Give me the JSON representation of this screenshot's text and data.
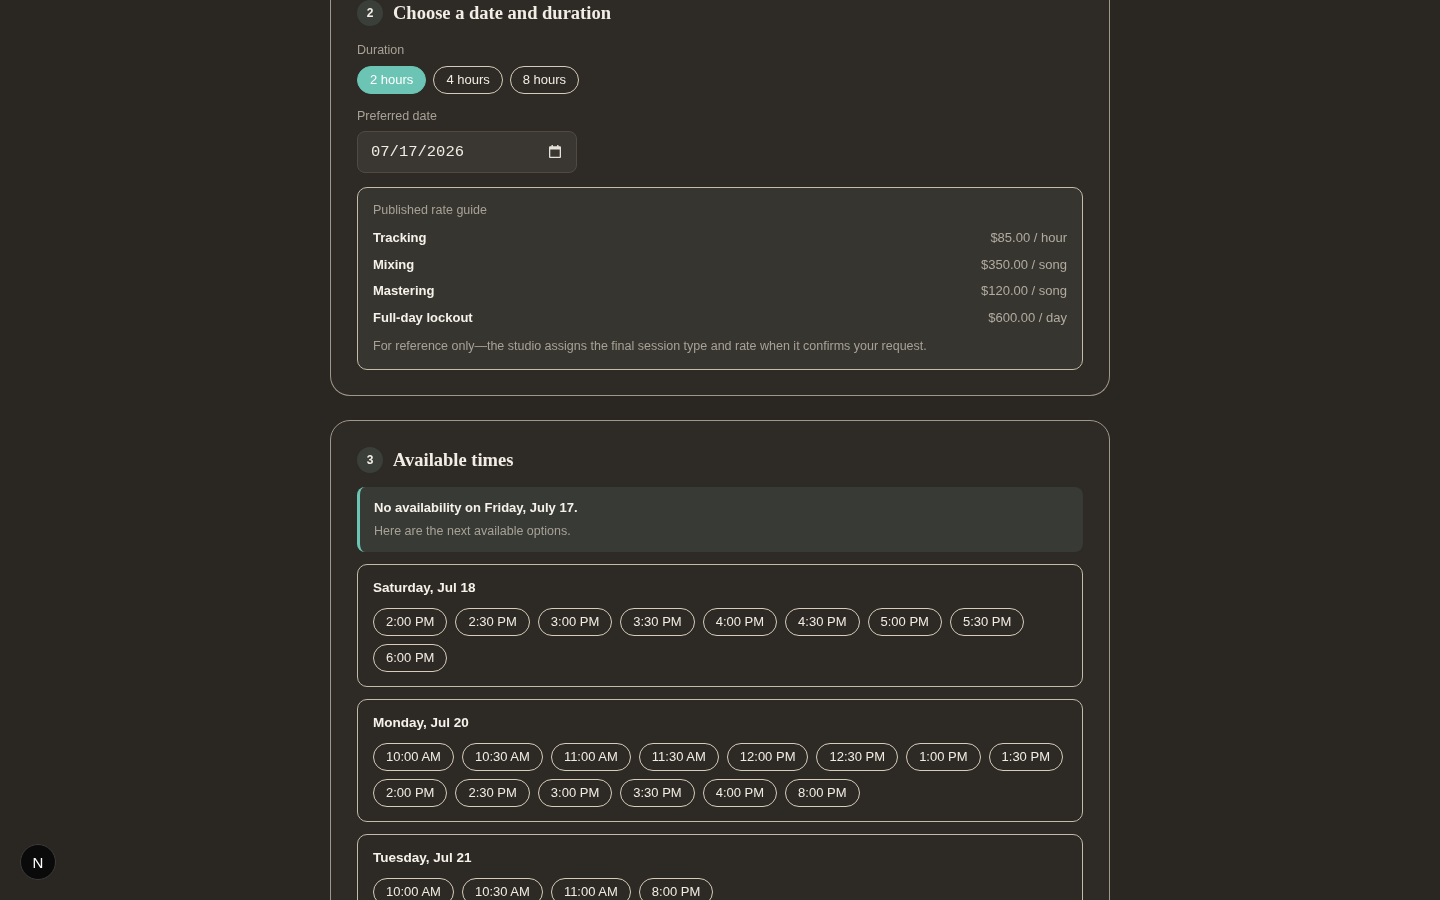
{
  "date_section": {
    "step": "2",
    "title": "Choose a date and duration",
    "duration": {
      "label": "Duration",
      "options": [
        {
          "label": "2 hours",
          "selected": true
        },
        {
          "label": "4 hours",
          "selected": false
        },
        {
          "label": "8 hours",
          "selected": false
        }
      ]
    },
    "date": {
      "label": "Preferred date",
      "value": "07/17/2026"
    },
    "rate_guide": {
      "title": "Published rate guide",
      "rows": [
        {
          "name": "Tracking",
          "price": "$85.00 / hour"
        },
        {
          "name": "Mixing",
          "price": "$350.00 / song"
        },
        {
          "name": "Mastering",
          "price": "$120.00 / song"
        },
        {
          "name": "Full-day lockout",
          "price": "$600.00 / day"
        }
      ],
      "note": "For reference only—the studio assigns the final session type and rate when it confirms your request."
    }
  },
  "times_section": {
    "step": "3",
    "title": "Available times",
    "notice": {
      "title": "No availability on Friday, July 17.",
      "text": "Here are the next available options."
    },
    "days": [
      {
        "label": "Saturday, Jul 18",
        "slots": [
          {
            "label": "2:00 PM",
            "selected": false
          },
          {
            "label": "2:30 PM",
            "selected": false
          },
          {
            "label": "3:00 PM",
            "selected": false
          },
          {
            "label": "3:30 PM",
            "selected": false
          },
          {
            "label": "4:00 PM",
            "selected": false
          },
          {
            "label": "4:30 PM",
            "selected": false
          },
          {
            "label": "5:00 PM",
            "selected": false
          },
          {
            "label": "5:30 PM",
            "selected": false
          },
          {
            "label": "6:00 PM",
            "selected": false
          }
        ]
      },
      {
        "label": "Monday, Jul 20",
        "slots": [
          {
            "label": "10:00 AM",
            "selected": false
          },
          {
            "label": "10:30 AM",
            "selected": false
          },
          {
            "label": "11:00 AM",
            "selected": false
          },
          {
            "label": "11:30 AM",
            "selected": false
          },
          {
            "label": "12:00 PM",
            "selected": false
          },
          {
            "label": "12:30 PM",
            "selected": false
          },
          {
            "label": "1:00 PM",
            "selected": false
          },
          {
            "label": "1:30 PM",
            "selected": false
          },
          {
            "label": "2:00 PM",
            "selected": false
          },
          {
            "label": "2:30 PM",
            "selected": false
          },
          {
            "label": "3:00 PM",
            "selected": false
          },
          {
            "label": "3:30 PM",
            "selected": false
          },
          {
            "label": "4:00 PM",
            "selected": false
          },
          {
            "label": "8:00 PM",
            "selected": false
          }
        ]
      },
      {
        "label": "Tuesday, Jul 21",
        "slots": [
          {
            "label": "10:00 AM",
            "selected": false
          },
          {
            "label": "10:30 AM",
            "selected": false
          },
          {
            "label": "11:00 AM",
            "selected": false
          },
          {
            "label": "8:00 PM",
            "selected": false
          }
        ]
      }
    ]
  },
  "floating_button": {
    "label": "N"
  }
}
